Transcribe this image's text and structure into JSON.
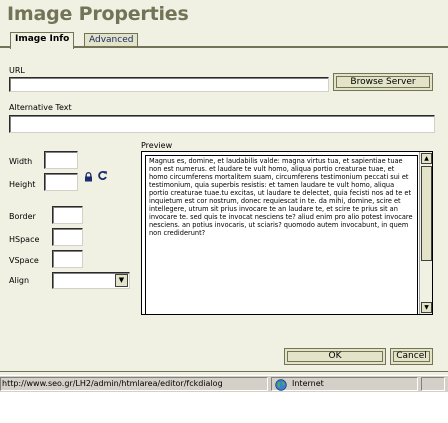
{
  "dialog": {
    "title": "Image Properties",
    "tabs": [
      {
        "label": "Image Info",
        "active": true
      },
      {
        "label": "Advanced",
        "active": false
      }
    ]
  },
  "form": {
    "url_label": "URL",
    "url_value": "",
    "browse_button": "Browse Server",
    "alt_label": "Alternative Text",
    "alt_value": "",
    "width_label": "Width",
    "width_value": "",
    "height_label": "Height",
    "height_value": "",
    "border_label": "Border",
    "border_value": "",
    "hspace_label": "HSpace",
    "hspace_value": "",
    "vspace_label": "VSpace",
    "vspace_value": "",
    "align_label": "Align",
    "align_value": ""
  },
  "preview": {
    "label": "Preview",
    "text": "Magnus es, domine, et laudabilis valde: magna virtus tua, et sapientiae tuae non est numerus. et laudare te vult homo, aliqua portio creaturae tuae, et homo circumferens mortalitem suam, circumferens testimonium peccati sui et testimonium, quia superbis resistis: et tamen laudare te vult homo, aliqua portio creaturae tuae.tu excitas, ut laudare te delectet, quia fecisti nos ad te et inquietum est cor nostrum, donec requiescat in te. da mihi, domine, scire et intellegere, utrum sit prius invocare te an laudare te, et scire te prius sit an invocare te. sed quis te invocat nesciens te? aliud enim pro alio potest invocare nesciens. an potius invocaris, ut sciaris? quomodo autem invocabunt, in quem non crediderunt?"
  },
  "buttons": {
    "ok": "OK",
    "cancel": "Cancel"
  },
  "status": {
    "url": "http://www.seo.gr/LH2/admin/htmlarea/editor/fckdialog",
    "zone": "Internet"
  },
  "colors": {
    "background": "#f1f1e3",
    "accent": "#737357",
    "tab_inactive_text": "#1c2b6d"
  }
}
